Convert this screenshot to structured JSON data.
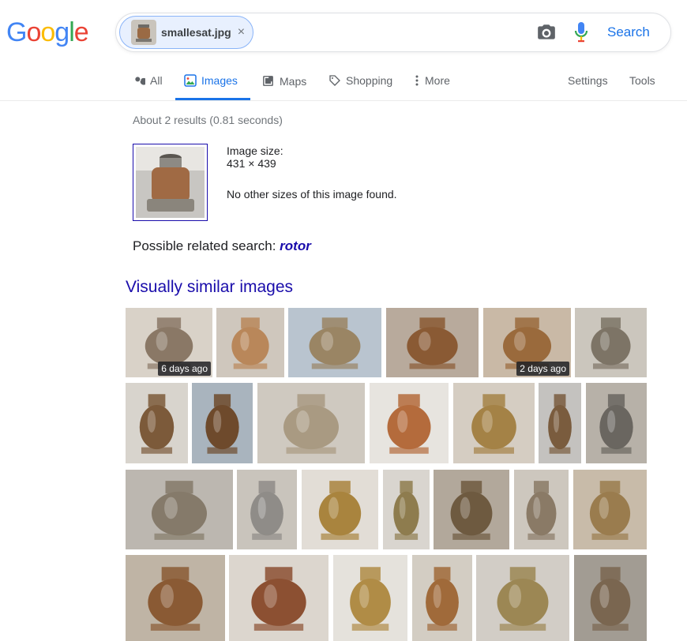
{
  "header": {
    "logo_letters": [
      "G",
      "o",
      "o",
      "g",
      "l",
      "e"
    ],
    "logo_colors": [
      "#4285F4",
      "#EA4335",
      "#FBBC05",
      "#4285F4",
      "#34A853",
      "#EA4335"
    ],
    "chip_label": "smallesat.jpg",
    "chip_close": "×",
    "search_label": "Search"
  },
  "tabs": {
    "all": "All",
    "images": "Images",
    "maps": "Maps",
    "shopping": "Shopping",
    "more": "More",
    "settings": "Settings",
    "tools": "Tools"
  },
  "results": {
    "stats": "About 2 results (0.81 seconds)",
    "image_size_label": "Image size:",
    "image_size_value": "431 × 439",
    "no_other_sizes": "No other sizes of this image found.",
    "related_prefix": "Possible related search: ",
    "related_term": "rotor",
    "similar_heading": "Visually similar images"
  },
  "similar_images": [
    {
      "badge": "6 days ago",
      "bg": "#d9d2c8",
      "obj": "#8a7866"
    },
    {
      "badge": "",
      "bg": "#cfc7bd",
      "obj": "#b9875a"
    },
    {
      "badge": "",
      "bg": "#b9c4cf",
      "obj": "#9a8564"
    },
    {
      "badge": "",
      "bg": "#b8aa9c",
      "obj": "#8a5a34"
    },
    {
      "badge": "2 days ago",
      "bg": "#c9b9a6",
      "obj": "#9a6a3c"
    },
    {
      "badge": "",
      "bg": "#cbc6bd",
      "obj": "#7d7466"
    },
    {
      "badge": "",
      "bg": "#d8d4cd",
      "obj": "#7c5a3a"
    },
    {
      "badge": "",
      "bg": "#a9b4be",
      "obj": "#6e4a2c"
    },
    {
      "badge": "",
      "bg": "#cfc9c0",
      "obj": "#a99a82"
    },
    {
      "badge": "",
      "bg": "#e7e4df",
      "obj": "#b46b3c"
    },
    {
      "badge": "",
      "bg": "#d5cdc2",
      "obj": "#a48246"
    },
    {
      "badge": "",
      "bg": "#c4c2bf",
      "obj": "#7a5c3e"
    },
    {
      "badge": "",
      "bg": "#b7b1a8",
      "obj": "#6a6660"
    },
    {
      "badge": "",
      "bg": "#bcb7b0",
      "obj": "#857a6a"
    },
    {
      "badge": "",
      "bg": "#c9c4bc",
      "obj": "#8f8c88"
    },
    {
      "badge": "",
      "bg": "#e2ddd6",
      "obj": "#a9843e"
    },
    {
      "badge": "",
      "bg": "#d9d5cf",
      "obj": "#8e7c4e"
    },
    {
      "badge": "",
      "bg": "#b2a89b",
      "obj": "#6e5a40"
    },
    {
      "badge": "",
      "bg": "#cdc7be",
      "obj": "#8a7a66"
    },
    {
      "badge": "",
      "bg": "#c8bba9",
      "obj": "#9a7c4e"
    },
    {
      "badge": "",
      "bg": "#bfb4a5",
      "obj": "#8a5a34"
    },
    {
      "badge": "",
      "bg": "#dcd6ce",
      "obj": "#8c5032"
    },
    {
      "badge": "",
      "bg": "#e5e2dc",
      "obj": "#b08c46"
    },
    {
      "badge": "",
      "bg": "#d3cdc3",
      "obj": "#a06a3a"
    },
    {
      "badge": "",
      "bg": "#d2cdc6",
      "obj": "#9c8754"
    },
    {
      "badge": "",
      "bg": "#a29c93",
      "obj": "#7a6650"
    }
  ]
}
